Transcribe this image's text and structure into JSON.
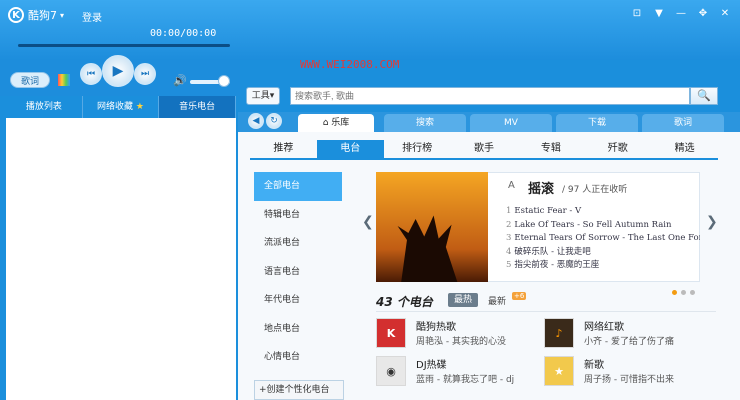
{
  "app": {
    "title": "酷狗7",
    "login": "登录"
  },
  "window_buttons": [
    "⊡",
    "▼",
    "—",
    "✥",
    "✕"
  ],
  "player": {
    "time": "00:00/00:00",
    "mode_label": "歌词",
    "progress": 0
  },
  "left_tabs": [
    {
      "label": "播放列表",
      "active": false
    },
    {
      "label": "网络收藏",
      "active": false
    },
    {
      "label": "音乐电台",
      "active": true
    }
  ],
  "toolbar": {
    "tools_label": "工具",
    "search_placeholder": "搜索歌手, 歌曲"
  },
  "watermark": "WWW.WEI2008.COM",
  "nav_tabs": [
    {
      "label": "乐库",
      "active": true
    },
    {
      "label": "搜索",
      "active": false
    },
    {
      "label": "MV",
      "active": false
    },
    {
      "label": "下载",
      "active": false
    },
    {
      "label": "歌词",
      "active": false
    }
  ],
  "subnav": [
    {
      "label": "推荐",
      "active": false
    },
    {
      "label": "电台",
      "active": true
    },
    {
      "label": "排行榜",
      "active": false
    },
    {
      "label": "歌手",
      "active": false
    },
    {
      "label": "专辑",
      "active": false
    },
    {
      "label": "歼歌",
      "active": false
    },
    {
      "label": "精选",
      "active": false
    }
  ],
  "side_list": [
    {
      "label": "全部电台",
      "active": true
    },
    {
      "label": "特辑电台",
      "active": false
    },
    {
      "label": "流派电台",
      "active": false
    },
    {
      "label": "语言电台",
      "active": false
    },
    {
      "label": "年代电台",
      "active": false
    },
    {
      "label": "地点电台",
      "active": false
    },
    {
      "label": "心情电台",
      "active": false
    }
  ],
  "create_label": "创建个性化电台",
  "featured": {
    "badge": "A",
    "title": "摇滚",
    "listening": "/ 97 人正在收听",
    "tracks": [
      {
        "n": "1",
        "text": "Estatic Fear - V"
      },
      {
        "n": "2",
        "text": "Lake Of Tears - So Fell Autumn Rain"
      },
      {
        "n": "3",
        "text": "Eternal Tears Of Sorrow - The Last One For Life"
      },
      {
        "n": "4",
        "text": "破碎乐队 - 让我走吧"
      },
      {
        "n": "5",
        "text": "指尖前夜 - 恶魔的王座"
      }
    ]
  },
  "stations_header": {
    "count": "43 个电台",
    "hot": "最热",
    "new": "最新",
    "new_badge": "+6"
  },
  "stations": [
    {
      "name": "酷狗热歌",
      "desc": "周艳泓 - 其实我的心没",
      "icon": "K"
    },
    {
      "name": "网络红歌",
      "desc": "小齐 - 爱了给了伤了痛",
      "icon": "♪"
    },
    {
      "name": "DJ热碟",
      "desc": "蓝雨 - 就算我忘了吧 - dj",
      "icon": "◉"
    },
    {
      "name": "新歌",
      "desc": "周子扬 - 可惜指不出来",
      "icon": "★"
    }
  ]
}
